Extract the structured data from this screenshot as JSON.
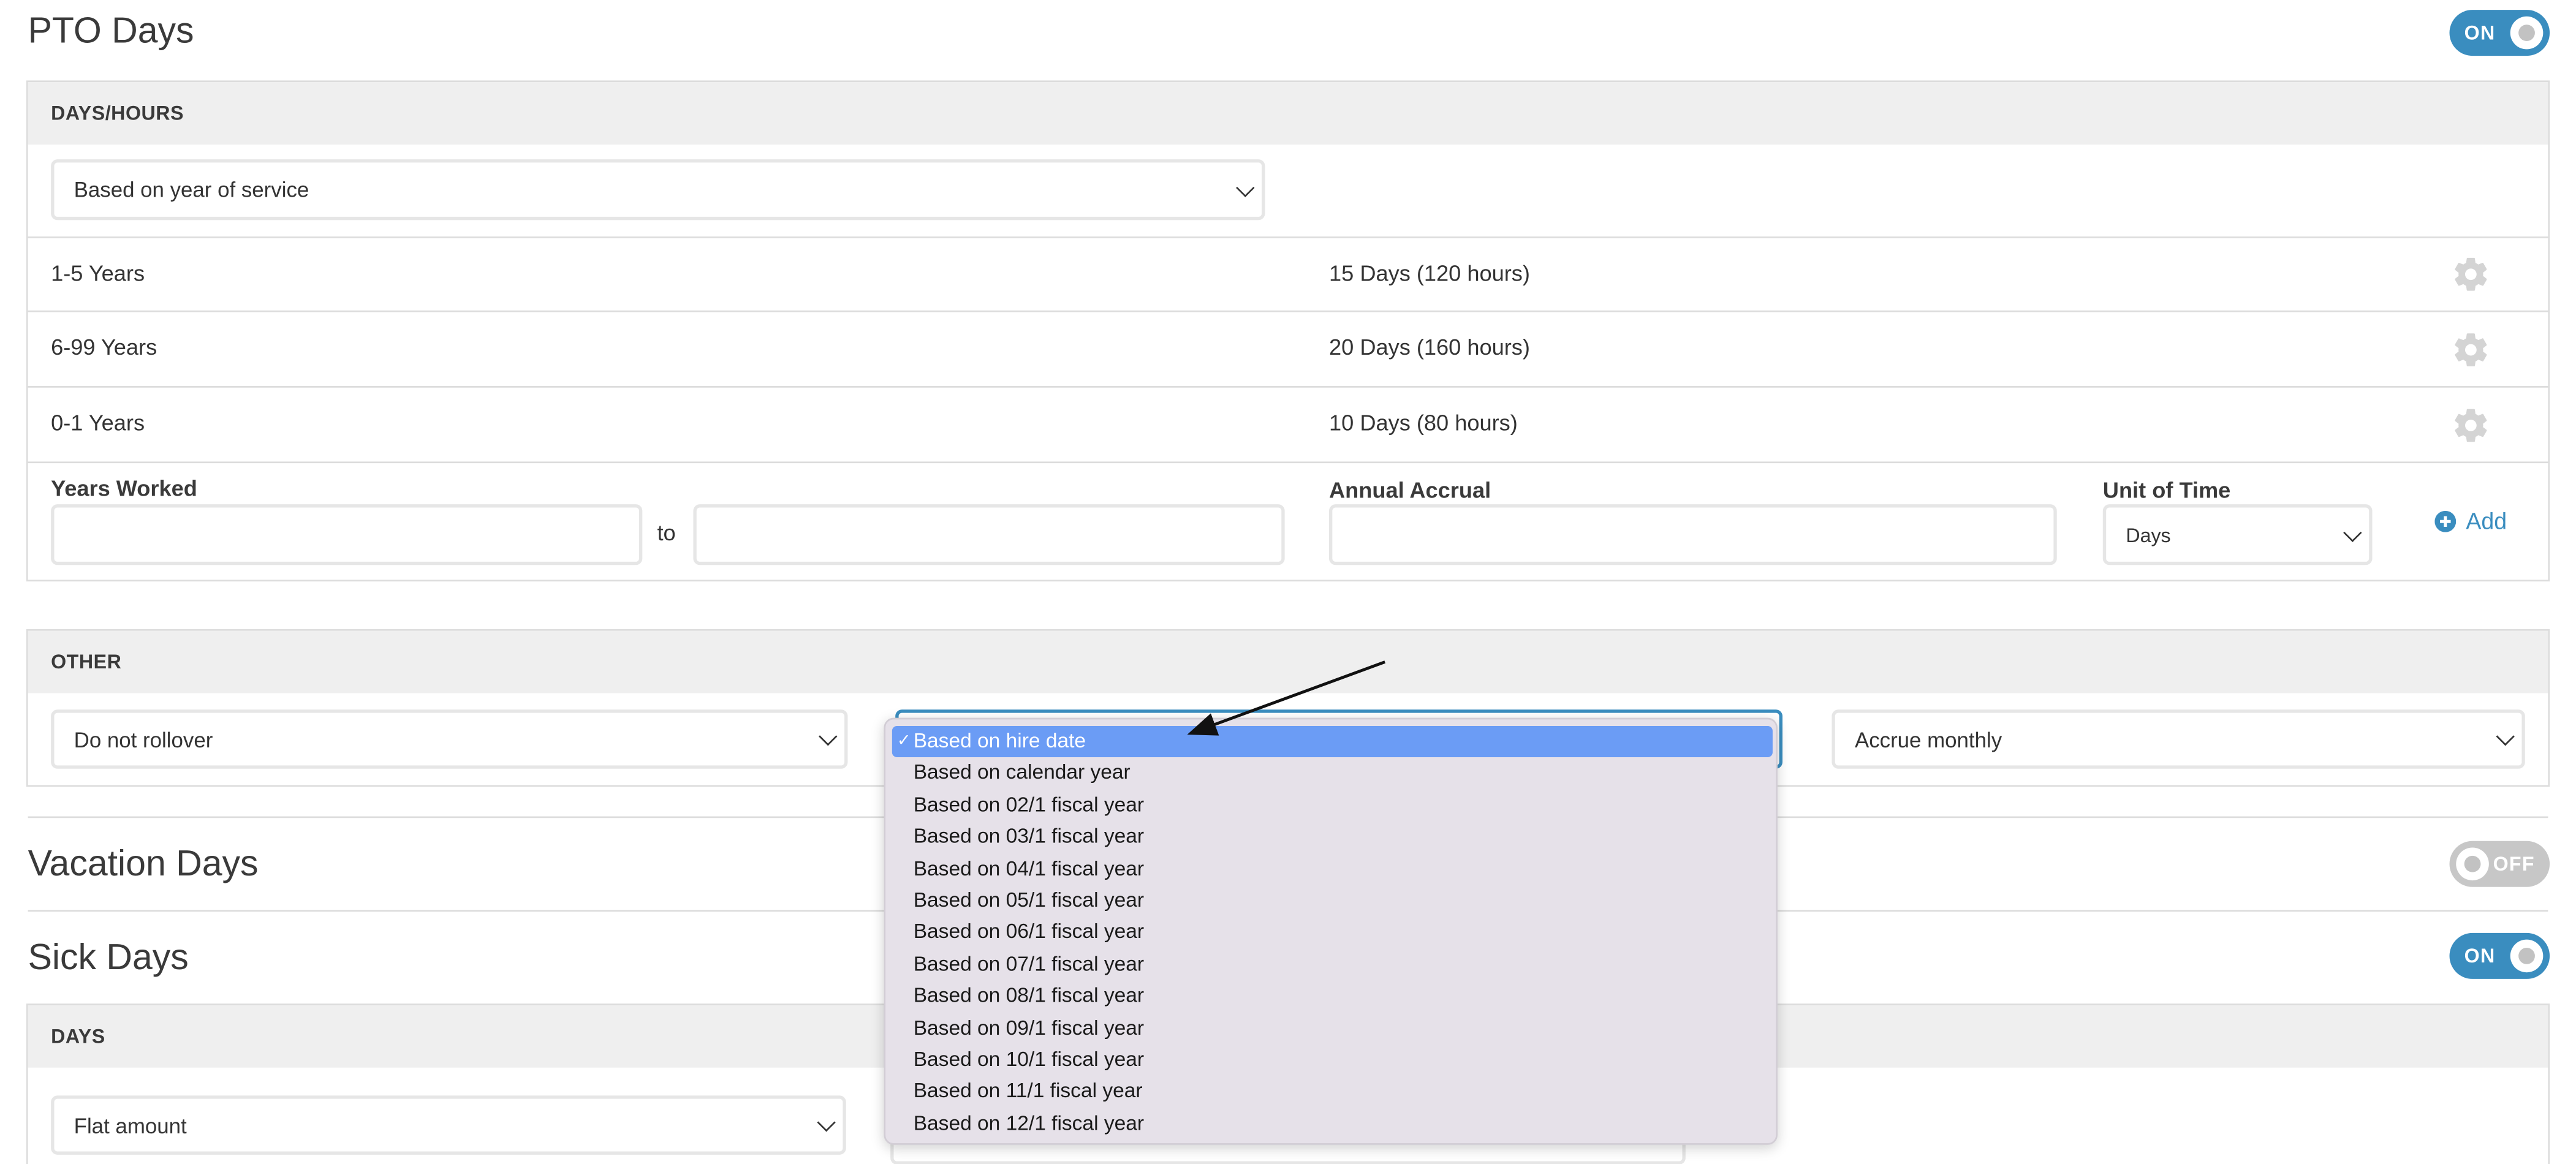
{
  "pto": {
    "title": "PTO Days",
    "toggle": "ON",
    "days_hours": {
      "header": "DAYS/HOURS",
      "method_select": "Based on year of service",
      "rows": [
        {
          "years": "1-5 Years",
          "amount": "15 Days (120 hours)",
          "icon": "gear-icon"
        },
        {
          "years": "6-99 Years",
          "amount": "20 Days (160 hours)",
          "icon": "gear-icon"
        },
        {
          "years": "0-1 Years",
          "amount": "10 Days (80 hours)",
          "icon": "gear-icon"
        }
      ],
      "form": {
        "years_worked_label": "Years Worked",
        "to_label": "to",
        "annual_accrual_label": "Annual Accrual",
        "unit_of_time_label": "Unit of Time",
        "unit_select": "Days",
        "add_label": "Add",
        "add_icon": "plus-circle-icon"
      }
    },
    "other": {
      "header": "OTHER",
      "rollover_select": "Do not rollover",
      "accrual_select": "Accrue monthly"
    }
  },
  "period_dropdown": {
    "options": [
      "Based on hire date",
      "Based on calendar year",
      "Based on 02/1 fiscal year",
      "Based on 03/1 fiscal year",
      "Based on 04/1 fiscal year",
      "Based on 05/1 fiscal year",
      "Based on 06/1 fiscal year",
      "Based on 07/1 fiscal year",
      "Based on 08/1 fiscal year",
      "Based on 09/1 fiscal year",
      "Based on 10/1 fiscal year",
      "Based on 11/1 fiscal year",
      "Based on 12/1 fiscal year"
    ],
    "selected": "Based on hire date",
    "check_mark": "✓"
  },
  "vacation": {
    "title": "Vacation Days",
    "toggle": "OFF"
  },
  "sick": {
    "title": "Sick Days",
    "toggle": "ON",
    "header": "DAYS",
    "method_select": "Flat amount"
  },
  "colors": {
    "accent": "#3a8dbf",
    "dropdown_bg": "#e6e1e9",
    "dropdown_selected": "#6b9cf5",
    "header_bg": "#efefef"
  }
}
